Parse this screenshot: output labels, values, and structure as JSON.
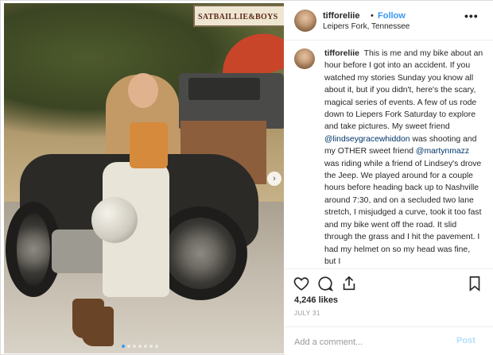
{
  "photo": {
    "sign_text": "SATBAILLIE&BOYS",
    "carousel_dots": 7,
    "carousel_active_index": 0
  },
  "header": {
    "username": "tifforeliie",
    "separator": "•",
    "follow_label": "Follow",
    "location": "Leipers Fork, Tennessee",
    "more_icon": "more-horizontal-icon"
  },
  "caption": {
    "username": "tifforeliie",
    "segments": [
      {
        "type": "text",
        "value": "This is me and my bike about an hour before I got into an accident. If you watched my stories Sunday you know all about it, but if you didn't, here's the scary, magical series of events. A few of us rode down to Liepers Fork Saturday to explore and take pictures. My sweet friend "
      },
      {
        "type": "mention",
        "value": "@lindseygracewhiddon"
      },
      {
        "type": "text",
        "value": " was shooting and my OTHER sweet friend "
      },
      {
        "type": "mention",
        "value": "@martynmazz"
      },
      {
        "type": "text",
        "value": " was riding while a friend of Lindsey's drove the Jeep. We played around for a couple hours before heading back up to Nashville around 7:30, and on a secluded two lane stretch, I misjudged a curve, took it too fast and my bike went off the road. It slid through the grass and I hit the pavement. I had my helmet on so my head was fine, but I"
      }
    ]
  },
  "actions": {
    "icons": [
      "heart-icon",
      "comment-icon",
      "share-icon",
      "bookmark-icon"
    ]
  },
  "likes": "4,246 likes",
  "date": "JULY 31",
  "comment": {
    "placeholder": "Add a comment...",
    "post_label": "Post"
  },
  "colors": {
    "accent": "#3897f0",
    "post_disabled": "#b2dffc",
    "mention": "#003569",
    "muted": "#999999"
  }
}
